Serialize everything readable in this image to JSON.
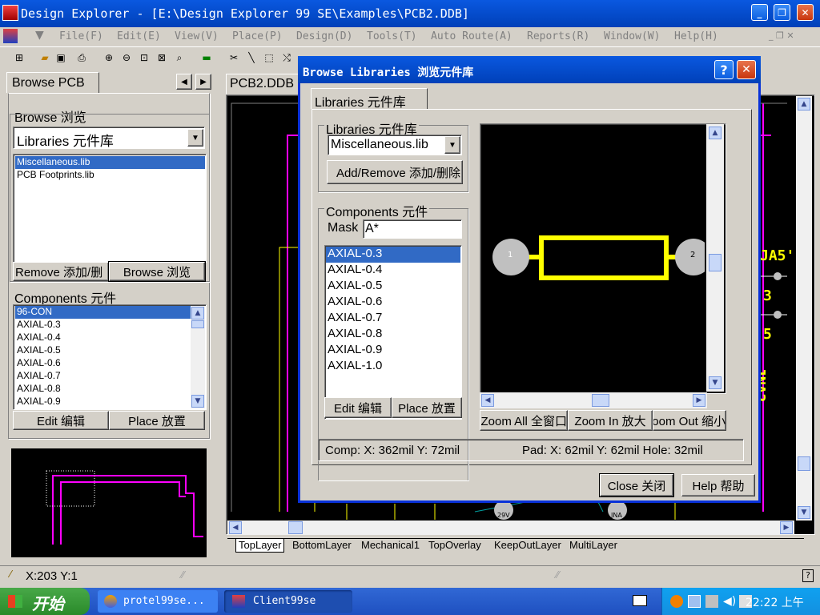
{
  "app": {
    "title": "Design Explorer - [E:\\Design Explorer 99 SE\\Examples\\PCB2.DDB]"
  },
  "menu": [
    "File(F)",
    "Edit(E)",
    "View(V)",
    "Place(P)",
    "Design(D)",
    "Tools(T)",
    "Auto Route(A)",
    "Reports(R)",
    "Window(W)",
    "Help(H)"
  ],
  "left_panel": {
    "tab": "Browse PCB",
    "browse_label": "Browse 浏览",
    "browse_value": "Libraries 元件库",
    "libraries": [
      "Miscellaneous.lib",
      "PCB Footprints.lib"
    ],
    "remove_btn": "Remove 添加/删",
    "browse_btn": "Browse 浏览",
    "components_label": "Components 元件",
    "components": [
      "96-CON",
      "AXIAL-0.3",
      "AXIAL-0.4",
      "AXIAL-0.5",
      "AXIAL-0.6",
      "AXIAL-0.7",
      "AXIAL-0.8",
      "AXIAL-0.9"
    ],
    "edit_btn": "Edit 编辑",
    "place_btn": "Place 放置"
  },
  "doc_tab": "PCB2.DDB",
  "pcb_labels": {
    "a": "JA5'",
    "b": "3",
    "c": "5",
    "d": "JNA2",
    "e": "29V",
    "f": "JNA"
  },
  "layer_tabs": [
    "TopLayer",
    "BottomLayer",
    "Mechanical1",
    "TopOverlay",
    "KeepOutLayer",
    "MultiLayer"
  ],
  "status": {
    "coords": "X:203 Y:1"
  },
  "dialog": {
    "title": "Browse Libraries 浏览元件库",
    "tab": "Libraries 元件库",
    "libraries_label": "Libraries 元件库",
    "library_value": "Miscellaneous.lib",
    "add_remove_btn": "Add/Remove 添加/删除",
    "components_label": "Components 元件",
    "mask_label": "Mask",
    "mask_value": "A*",
    "components": [
      "AXIAL-0.3",
      "AXIAL-0.4",
      "AXIAL-0.5",
      "AXIAL-0.6",
      "AXIAL-0.7",
      "AXIAL-0.8",
      "AXIAL-0.9",
      "AXIAL-1.0"
    ],
    "edit_btn": "Edit 编辑",
    "place_btn": "Place 放置",
    "pad1": "1",
    "pad2": "2",
    "zoom_all": "Zoom All 全窗口",
    "zoom_in": "Zoom In 放大",
    "zoom_out": "Zoom Out 缩小",
    "comp_info": "Comp: X: 362mil Y: 72mil",
    "pad_info": "Pad: X: 62mil Y: 62mil Hole: 32mil",
    "close_btn": "Close 关闭",
    "help_btn": "Help 帮助"
  },
  "taskbar": {
    "start": "开始",
    "items": [
      "protel99se...",
      "Client99se"
    ],
    "clock": "22:22 上午"
  },
  "colors": {
    "xp_title": "#0a246a",
    "selection": "#316ac5",
    "pcb_yellow": "#ffff00",
    "pcb_magenta": "#ff00ff"
  }
}
